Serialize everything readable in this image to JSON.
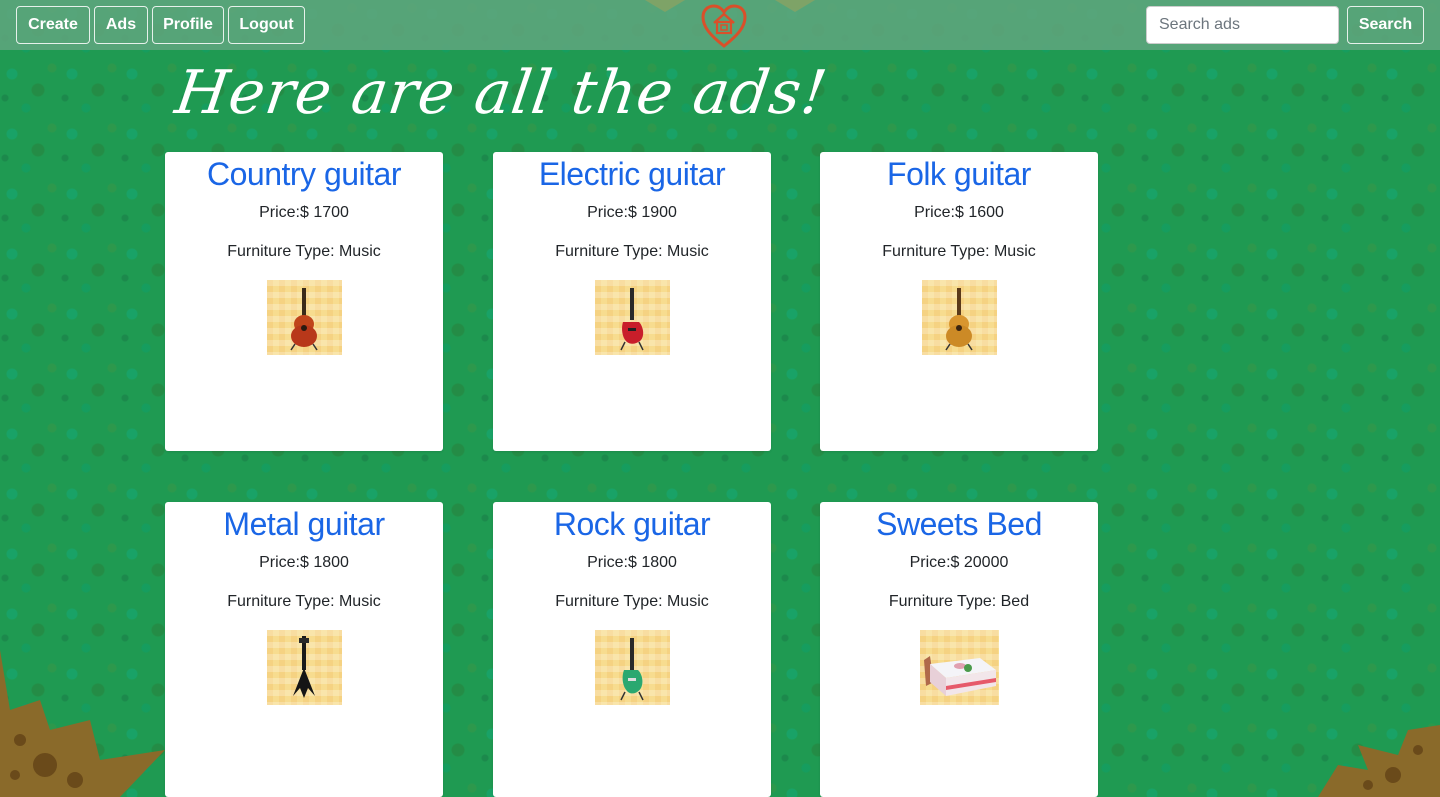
{
  "nav": {
    "create_label": "Create",
    "ads_label": "Ads",
    "profile_label": "Profile",
    "logout_label": "Logout",
    "search_placeholder": "Search ads",
    "search_button_label": "Search",
    "logo_icon": "house-heart-icon"
  },
  "page": {
    "title": "Here are all the ads!"
  },
  "ads": [
    {
      "title": "Country guitar",
      "price": "Price:$ 1700",
      "type": "Furniture Type: Music",
      "icon": "acoustic-guitar-icon"
    },
    {
      "title": "Electric guitar",
      "price": "Price:$ 1900",
      "type": "Furniture Type: Music",
      "icon": "electric-guitar-icon"
    },
    {
      "title": "Folk guitar",
      "price": "Price:$ 1600",
      "type": "Furniture Type: Music",
      "icon": "acoustic-guitar-icon"
    },
    {
      "title": "Metal guitar",
      "price": "Price:$ 1800",
      "type": "Furniture Type: Music",
      "icon": "metal-guitar-icon"
    },
    {
      "title": "Rock guitar",
      "price": "Price:$ 1800",
      "type": "Furniture Type: Music",
      "icon": "electric-guitar-icon"
    },
    {
      "title": "Sweets Bed",
      "price": "Price:$ 20000",
      "type": "Furniture Type: Bed",
      "icon": "bed-icon"
    }
  ],
  "colors": {
    "background": "#1f9a52",
    "navbar": "#5fa57d",
    "card_title": "#1a66e6",
    "logo": "#d9502a"
  }
}
